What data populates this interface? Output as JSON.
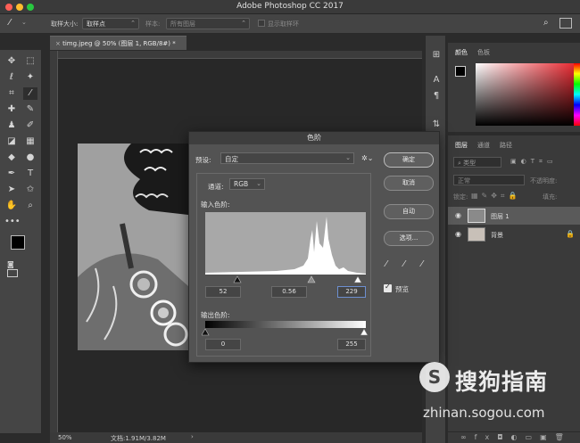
{
  "app": {
    "title": "Adobe Photoshop CC 2017"
  },
  "options_bar": {
    "sample_size_label": "取样大小:",
    "sample_size_value": "取样点",
    "sample_label": "样本:",
    "sample_value": "所有图层",
    "show_ring_label": "显示取样环"
  },
  "document": {
    "tab_label": "timg.jpeg @ 50% (图层 1, RGB/8#) *",
    "zoom": "50%",
    "doc_info": "文档:1.91M/3.82M"
  },
  "color_panel": {
    "tabs": [
      "颜色",
      "色板"
    ]
  },
  "layers_panel": {
    "tabs": [
      "图层",
      "通道",
      "路径"
    ],
    "filter_label": "类型",
    "blend_mode": "正常",
    "opacity_label": "不透明度:",
    "lock_label": "锁定:",
    "fill_label": "填充:",
    "layers": [
      {
        "name": "图层 1",
        "selected": true
      },
      {
        "name": "背景",
        "selected": false
      }
    ]
  },
  "levels_dialog": {
    "title": "色阶",
    "preset_label": "预设:",
    "preset_value": "自定",
    "channel_label": "通道:",
    "channel_value": "RGB",
    "input_levels_label": "输入色阶:",
    "input_black": "52",
    "input_gamma": "0.56",
    "input_white": "229",
    "output_levels_label": "输出色阶:",
    "output_black": "0",
    "output_white": "255",
    "buttons": {
      "ok": "确定",
      "cancel": "取消",
      "auto": "自动",
      "options": "选项..."
    },
    "preview_label": "预览",
    "preview_checked": true
  },
  "watermark": {
    "logo_char": "S",
    "brand": "搜狗指南",
    "url": "zhinan.sogou.com"
  }
}
